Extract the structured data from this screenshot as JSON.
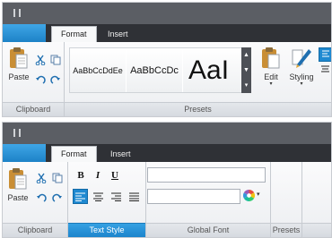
{
  "ribbon_top": {
    "tabs": [
      {
        "label": "Format",
        "active": true
      },
      {
        "label": "Insert",
        "active": false
      }
    ],
    "groups": {
      "clipboard": {
        "label": "Clipboard",
        "paste_label": "Paste",
        "icons": [
          "paste-icon",
          "cut-icon",
          "copy-icon",
          "undo-icon",
          "redo-icon"
        ]
      },
      "presets": {
        "label": "Presets",
        "items": [
          "AaBbCcDdEe",
          "AaBbCcDc",
          "AaI"
        ],
        "edit_label": "Edit",
        "styling_label": "Styling"
      }
    }
  },
  "ribbon_bottom": {
    "tabs": [
      {
        "label": "Format",
        "active": true
      },
      {
        "label": "Insert",
        "active": false
      }
    ],
    "groups": {
      "clipboard": {
        "label": "Clipboard",
        "paste_label": "Paste"
      },
      "text_style": {
        "label": "Text Style",
        "bold": "B",
        "italic": "I",
        "underline": "U",
        "alignment_selected": "left"
      },
      "global_font": {
        "label": "Global Font",
        "font_value": "",
        "size_value": ""
      },
      "presets": {
        "label": "Presets"
      }
    }
  },
  "colors": {
    "accent": "#1f89d1",
    "titlebar": "#5b5e64",
    "tabstrip": "#2f3136"
  }
}
